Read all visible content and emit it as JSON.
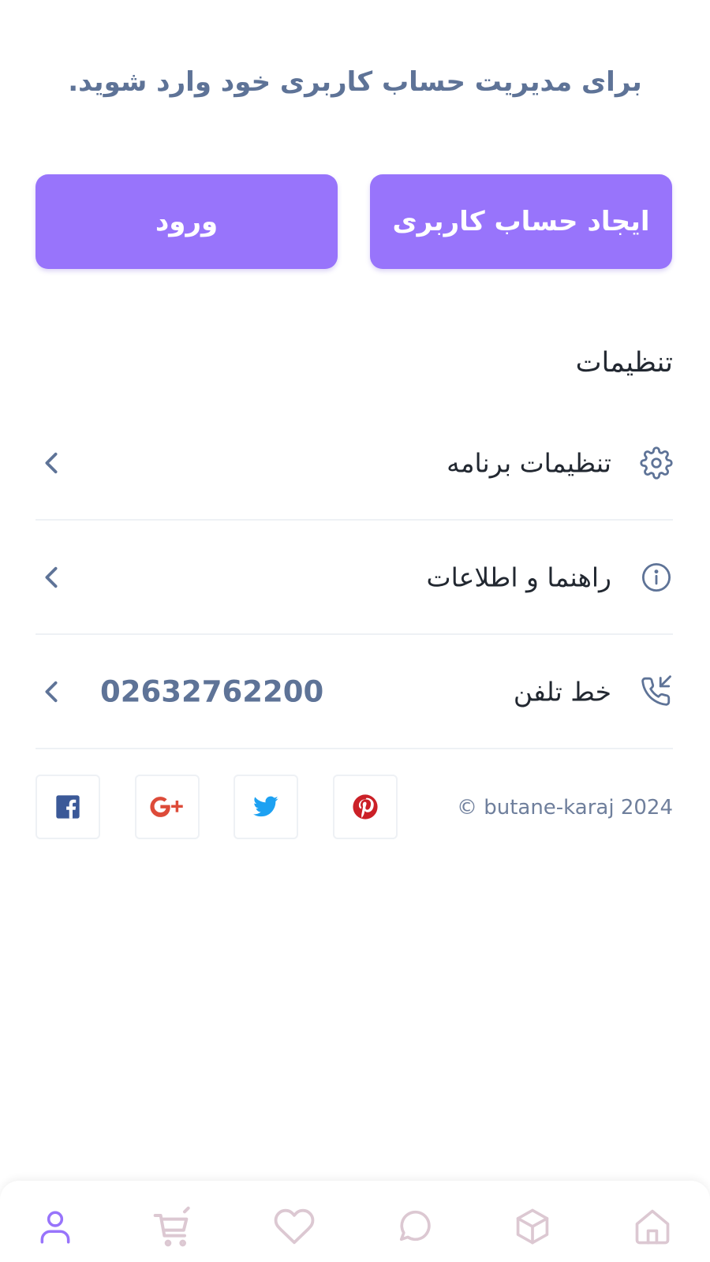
{
  "intro": {
    "message": "برای مدیریت حساب کاربری خود وارد شوید."
  },
  "auth": {
    "register_label": "ایجاد حساب کاربری",
    "login_label": "ورود"
  },
  "settings": {
    "title": "تنظیمات",
    "items": [
      {
        "label": "تنظیمات برنامه",
        "icon": "gear-icon"
      },
      {
        "label": "راهنما و اطلاعات",
        "icon": "info-icon"
      },
      {
        "label": "خط تلفن",
        "icon": "phone-icon",
        "value": "02632762200"
      }
    ]
  },
  "footer": {
    "copyright": "© butane-karaj 2024",
    "social": [
      {
        "name": "facebook",
        "color": "#3b5998"
      },
      {
        "name": "google-plus",
        "color": "#dd4b39"
      },
      {
        "name": "twitter",
        "color": "#1da1f2"
      },
      {
        "name": "pinterest",
        "color": "#cb2027"
      }
    ]
  },
  "bottom_nav": {
    "items": [
      {
        "name": "profile",
        "icon": "user-icon",
        "active": true,
        "color": "#9874fb"
      },
      {
        "name": "cart",
        "icon": "cart-icon",
        "active": false,
        "color": "#dcc8d2"
      },
      {
        "name": "wishlist",
        "icon": "heart-icon",
        "active": false,
        "color": "#dcc8d2"
      },
      {
        "name": "search",
        "icon": "chat-icon",
        "active": false,
        "color": "#dcc8d2"
      },
      {
        "name": "categories",
        "icon": "box-icon",
        "active": false,
        "color": "#dcc8d2"
      },
      {
        "name": "home",
        "icon": "home-icon",
        "active": false,
        "color": "#dcc8d2"
      }
    ]
  },
  "colors": {
    "accent": "#9874fb",
    "text_muted": "#5e7397",
    "text_dark": "#222831",
    "divider": "#eef1f5"
  }
}
